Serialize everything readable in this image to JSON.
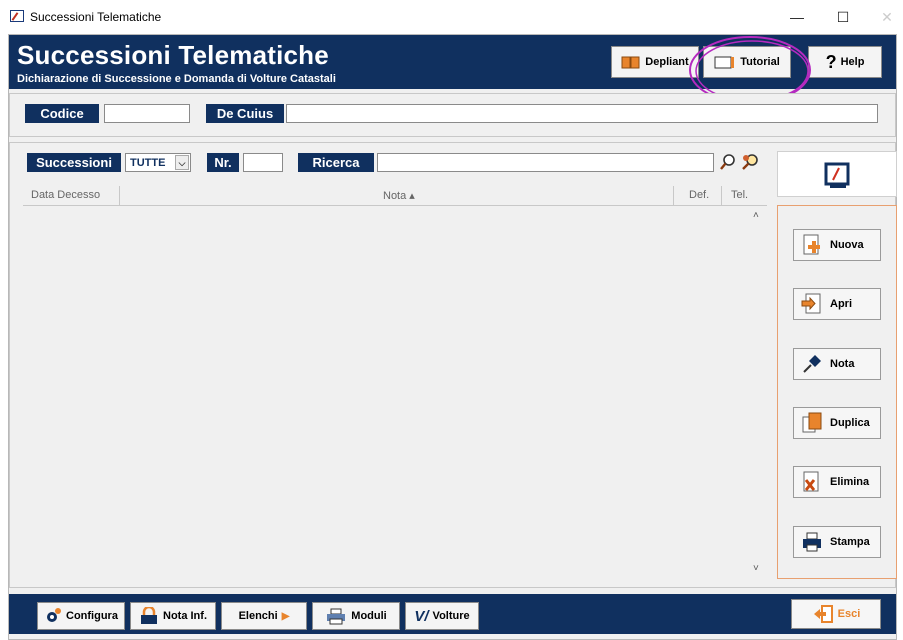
{
  "window": {
    "title": "Successioni Telematiche",
    "minimize": "—",
    "maximize": "☐",
    "close": "✕"
  },
  "header": {
    "brand": "Successioni Telematiche",
    "subtitle": "Dichiarazione di Successione e Domanda di Volture Catastali",
    "buttons": {
      "depliant": "Depliant",
      "tutorial": "Tutorial",
      "help": "Help"
    }
  },
  "search_row": {
    "codice_label": "Codice",
    "codice_value": "",
    "decuius_label": "De Cuius",
    "decuius_value": ""
  },
  "filter_row": {
    "successioni_label": "Successioni",
    "successioni_select": "TUTTE",
    "nr_label": "Nr.",
    "nr_value": "",
    "ricerca_label": "Ricerca",
    "ricerca_value": ""
  },
  "table": {
    "columns": [
      "Data Decesso",
      "Nota ▴",
      "Def.",
      "Tel."
    ],
    "rows": []
  },
  "side_buttons": [
    "Nuova",
    "Apri",
    "Nota",
    "Duplica",
    "Elimina",
    "Stampa"
  ],
  "footer": {
    "configura": "Configura",
    "nota_inf": "Nota Inf.",
    "elenchi": "Elenchi",
    "moduli": "Moduli",
    "volture": "Volture",
    "esci": "Esci"
  },
  "colors": {
    "navy": "#10305f",
    "highlight_circle": "#b52ac0",
    "panel_border": "#e8a070"
  }
}
